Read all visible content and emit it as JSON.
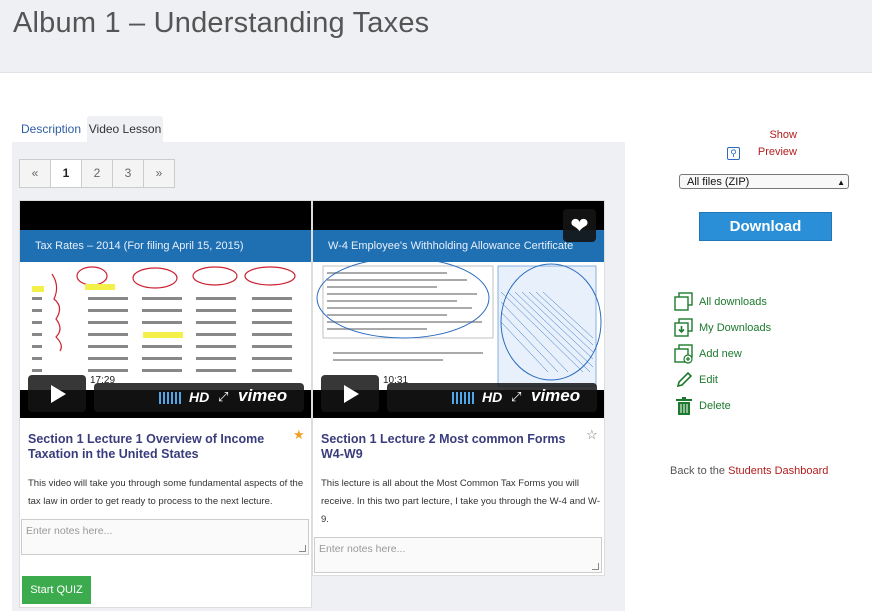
{
  "page": {
    "title": "Album 1 – Understanding Taxes"
  },
  "tabs": [
    {
      "label": "Description",
      "active": false
    },
    {
      "label": "Video Lesson",
      "active": true
    }
  ],
  "pagination": {
    "prev": "«",
    "pages": [
      "1",
      "2",
      "3"
    ],
    "active": "1",
    "next": "»"
  },
  "lectures": [
    {
      "title": "Section 1 Lecture 1 Overview of Income Taxation in the United States",
      "description": "This video will take you through some fundamental aspects of the tax law in order to get ready to process to the next lecture.",
      "duration": "17:29",
      "slide_title": "Tax Rates – 2014 (For filing April 15, 2015)",
      "starred": true,
      "notes_placeholder": "Enter notes here...",
      "quiz_label": "Start QUIZ"
    },
    {
      "title": "Section 1 Lecture 2 Most common Forms W4-W9",
      "description": "This lecture is all about the Most Common Tax Forms you will receive. In this two part lecture, I take you through the W-4 and W-9.",
      "duration": "10:31",
      "slide_title": "W-4 Employee's Withholding Allowance Certificate",
      "starred": false,
      "notes_placeholder": "Enter notes here..."
    }
  ],
  "player": {
    "hd": "HD",
    "brand": "vimeo"
  },
  "sidebar": {
    "show_preview": "Show Preview",
    "file_select": "All files (ZIP)",
    "download": "Download",
    "actions": [
      {
        "label": "All downloads",
        "icon": "folders-icon"
      },
      {
        "label": "My Downloads",
        "icon": "download-folder-icon"
      },
      {
        "label": "Add new",
        "icon": "add-folder-icon"
      },
      {
        "label": "Edit",
        "icon": "pencil-icon"
      },
      {
        "label": "Delete",
        "icon": "trash-icon"
      }
    ],
    "back_prefix": "Back to the",
    "back_link": "Students Dashboard"
  },
  "colors": {
    "accent": "#2a8fd6",
    "link_red": "#b31d1d",
    "green": "#1d7a2d",
    "title_purple": "#3a3d7c",
    "quiz_green": "#3cab4e"
  }
}
